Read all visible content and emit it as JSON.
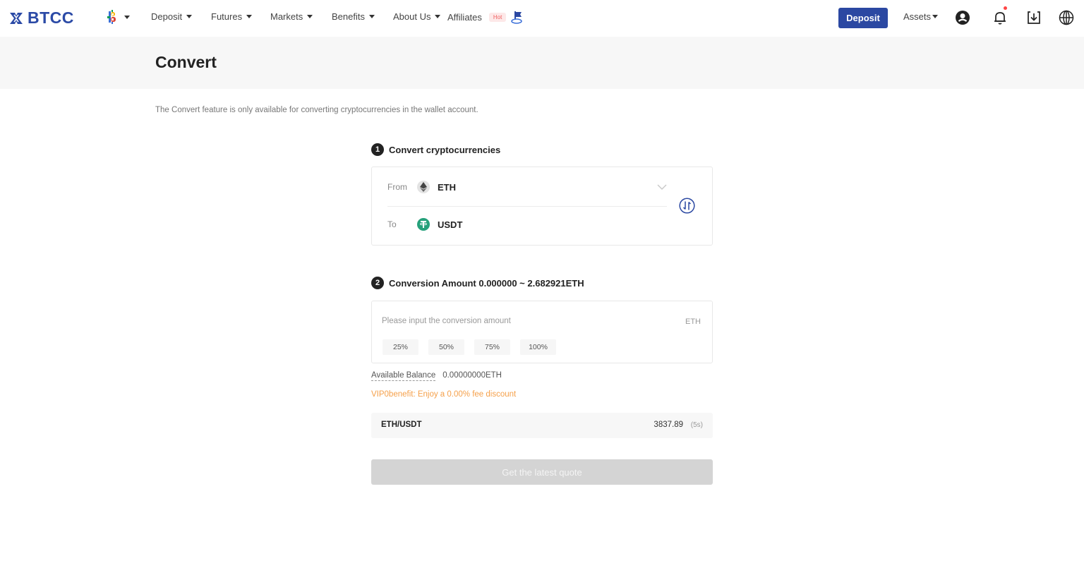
{
  "header": {
    "logo_text": "BTCC",
    "nav": [
      {
        "label": "Deposit"
      },
      {
        "label": "Futures"
      },
      {
        "label": "Markets"
      },
      {
        "label": "Benefits"
      },
      {
        "label": "About Us"
      },
      {
        "label": "Affiliates",
        "badge": "Hot"
      }
    ],
    "deposit_button": "Deposit",
    "assets_label": "Assets",
    "brand_color": "#2b48a2",
    "has_notification": true
  },
  "page": {
    "title": "Convert",
    "notice": "The Convert feature is only available for converting cryptocurrencies in the wallet account."
  },
  "step1": {
    "number": "1",
    "title": "Convert cryptocurrencies",
    "from_label": "From",
    "from_coin": "ETH",
    "to_label": "To",
    "to_coin": "USDT"
  },
  "step2": {
    "number": "2",
    "title": "Conversion Amount 0.000000 ~ 2.682921ETH",
    "input_value": "",
    "input_placeholder": "Please input the conversion amount",
    "unit": "ETH",
    "percent_buttons": [
      "25%",
      "50%",
      "75%",
      "100%"
    ]
  },
  "balance": {
    "label": "Available Balance",
    "value": "0.00000000ETH"
  },
  "vip_benefit": "VIP0benefit: Enjoy a 0.00% fee discount",
  "rate": {
    "pair": "ETH/USDT",
    "value": "3837.89",
    "timer": "(5s)"
  },
  "quote_button": "Get the latest quote"
}
